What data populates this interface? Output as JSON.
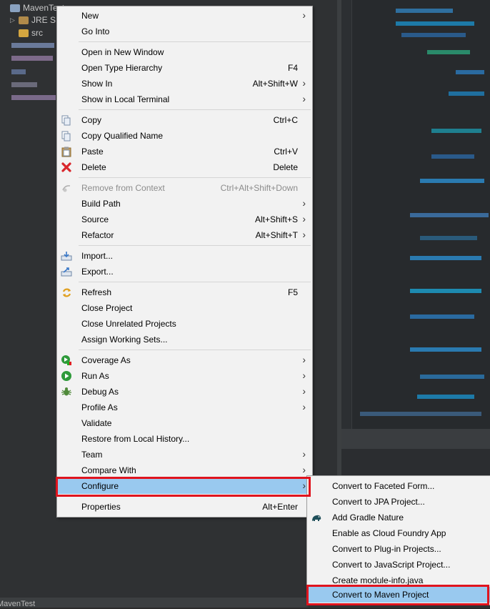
{
  "project_tree": {
    "project_name": "MavenTest",
    "items": [
      {
        "label": "JRE S"
      },
      {
        "label": "src"
      }
    ]
  },
  "status_bar": {
    "text": "MavenTest"
  },
  "context_menu": {
    "items": [
      {
        "label": "New",
        "shortcut": "",
        "submenu": true
      },
      {
        "label": "Go Into",
        "shortcut": ""
      },
      {
        "label": "Open in New Window",
        "shortcut": ""
      },
      {
        "label": "Open Type Hierarchy",
        "shortcut": "F4"
      },
      {
        "label": "Show In",
        "shortcut": "Alt+Shift+W",
        "submenu": true
      },
      {
        "label": "Show in Local Terminal",
        "shortcut": "",
        "submenu": true
      },
      {
        "label": "Copy",
        "shortcut": "Ctrl+C",
        "icon": "copy-icon"
      },
      {
        "label": "Copy Qualified Name",
        "shortcut": "",
        "icon": "copy-qualified-icon"
      },
      {
        "label": "Paste",
        "shortcut": "Ctrl+V",
        "icon": "paste-icon"
      },
      {
        "label": "Delete",
        "shortcut": "Delete",
        "icon": "delete-icon"
      },
      {
        "label": "Remove from Context",
        "shortcut": "Ctrl+Alt+Shift+Down",
        "icon": "remove-context-icon",
        "disabled": true
      },
      {
        "label": "Build Path",
        "shortcut": "",
        "submenu": true
      },
      {
        "label": "Source",
        "shortcut": "Alt+Shift+S",
        "submenu": true
      },
      {
        "label": "Refactor",
        "shortcut": "Alt+Shift+T",
        "submenu": true
      },
      {
        "label": "Import...",
        "shortcut": "",
        "icon": "import-icon"
      },
      {
        "label": "Export...",
        "shortcut": "",
        "icon": "export-icon"
      },
      {
        "label": "Refresh",
        "shortcut": "F5",
        "icon": "refresh-icon"
      },
      {
        "label": "Close Project",
        "shortcut": ""
      },
      {
        "label": "Close Unrelated Projects",
        "shortcut": ""
      },
      {
        "label": "Assign Working Sets...",
        "shortcut": ""
      },
      {
        "label": "Coverage As",
        "shortcut": "",
        "submenu": true,
        "icon": "coverage-icon"
      },
      {
        "label": "Run As",
        "shortcut": "",
        "submenu": true,
        "icon": "run-icon"
      },
      {
        "label": "Debug As",
        "shortcut": "",
        "submenu": true,
        "icon": "debug-icon"
      },
      {
        "label": "Profile As",
        "shortcut": "",
        "submenu": true
      },
      {
        "label": "Validate",
        "shortcut": ""
      },
      {
        "label": "Restore from Local History...",
        "shortcut": ""
      },
      {
        "label": "Team",
        "shortcut": "",
        "submenu": true
      },
      {
        "label": "Compare With",
        "shortcut": "",
        "submenu": true
      },
      {
        "label": "Configure",
        "shortcut": "",
        "submenu": true,
        "selected": true
      },
      {
        "label": "Properties",
        "shortcut": "Alt+Enter"
      }
    ]
  },
  "configure_submenu": {
    "items": [
      {
        "label": "Convert to Faceted Form..."
      },
      {
        "label": "Convert to JPA Project..."
      },
      {
        "label": "Add Gradle Nature",
        "icon": "gradle-elephant-icon"
      },
      {
        "label": "Enable as Cloud Foundry App"
      },
      {
        "label": "Convert to Plug-in Projects..."
      },
      {
        "label": "Convert to JavaScript Project..."
      },
      {
        "label": "Create module-info.java"
      },
      {
        "label": "Convert to Maven Project",
        "selected": true
      }
    ]
  },
  "colors": {
    "menu_bg": "#f2f2f2",
    "selection": "#99c9ef",
    "highlight_box": "#e0141e",
    "ide_dark": "#2b2b2b"
  }
}
